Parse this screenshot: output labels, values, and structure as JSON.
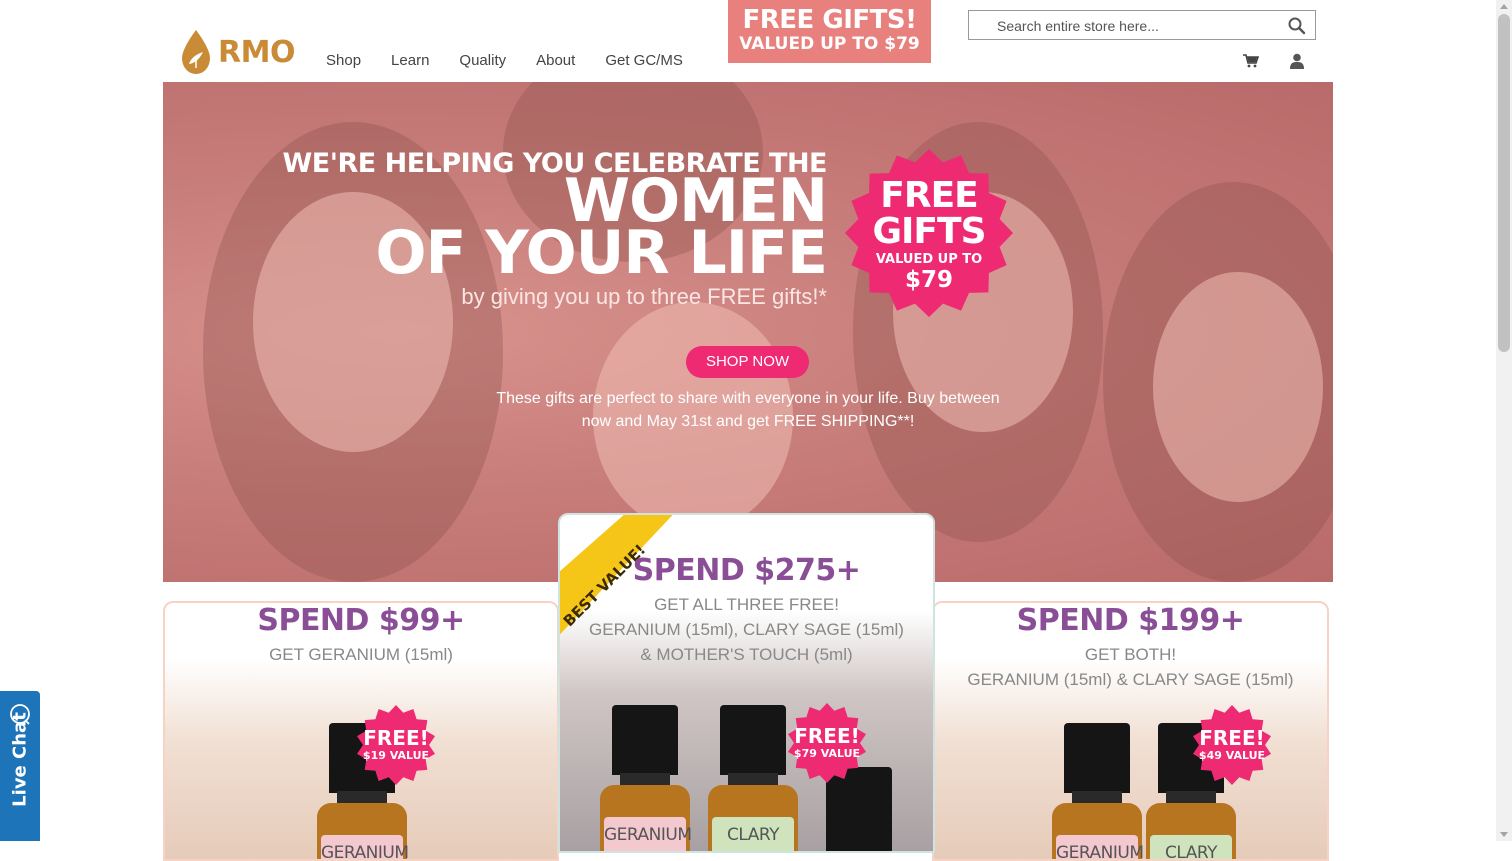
{
  "header": {
    "logo_text": "RMO",
    "nav": [
      "Shop",
      "Learn",
      "Quality",
      "About",
      "Get GC/MS"
    ],
    "promo_line1": "FREE GIFTS!",
    "promo_line2": "VALUED UP TO $79",
    "search_placeholder": "Search entire store here..."
  },
  "hero": {
    "line1": "WE'RE HELPING YOU CELEBRATE THE",
    "line2": "WOMEN",
    "line3": "OF YOUR LIFE",
    "sub": "by giving you up to three FREE gifts!*",
    "burst_line1": "FREE",
    "burst_line2": "GIFTS",
    "burst_line3": "VALUED UP TO",
    "burst_line4": "$79",
    "shop_button": "SHOP NOW",
    "desc_line1": "These gifts are perfect to share with everyone in your life. Buy between",
    "desc_line2": "now and May 31st and get FREE SHIPPING**!"
  },
  "offers": {
    "left": {
      "title": "SPEND $99+",
      "line1": "GET GERANIUM (15ml)",
      "badge_free": "FREE!",
      "badge_value": "$19 VALUE",
      "bottle_label": "GERANIUM"
    },
    "middle": {
      "ribbon": "BEST VALUE!",
      "title": "SPEND $275+",
      "line1": "GET ALL THREE FREE!",
      "line2": "GERANIUM (15ml), CLARY SAGE (15ml)",
      "line3": "& MOTHER'S TOUCH (5ml)",
      "badge_free": "FREE!",
      "badge_value": "$79 VALUE",
      "bottle1_label": "GERANIUM",
      "bottle2_label": "CLARY"
    },
    "right": {
      "title": "SPEND $199+",
      "line1": "GET BOTH!",
      "line2": "GERANIUM (15ml) & CLARY SAGE (15ml)",
      "badge_free": "FREE!",
      "badge_value": "$49 VALUE",
      "bottle1_label": "GERANIUM",
      "bottle2_label": "CLARY"
    }
  },
  "live_chat": "Live Chat",
  "colors": {
    "brand_gold": "#c98b35",
    "promo_coral": "#e8817e",
    "accent_pink": "#ee2a72",
    "offer_purple": "#8a4e96",
    "ribbon_yellow": "#f5c518",
    "chat_blue": "#1e74b8"
  }
}
